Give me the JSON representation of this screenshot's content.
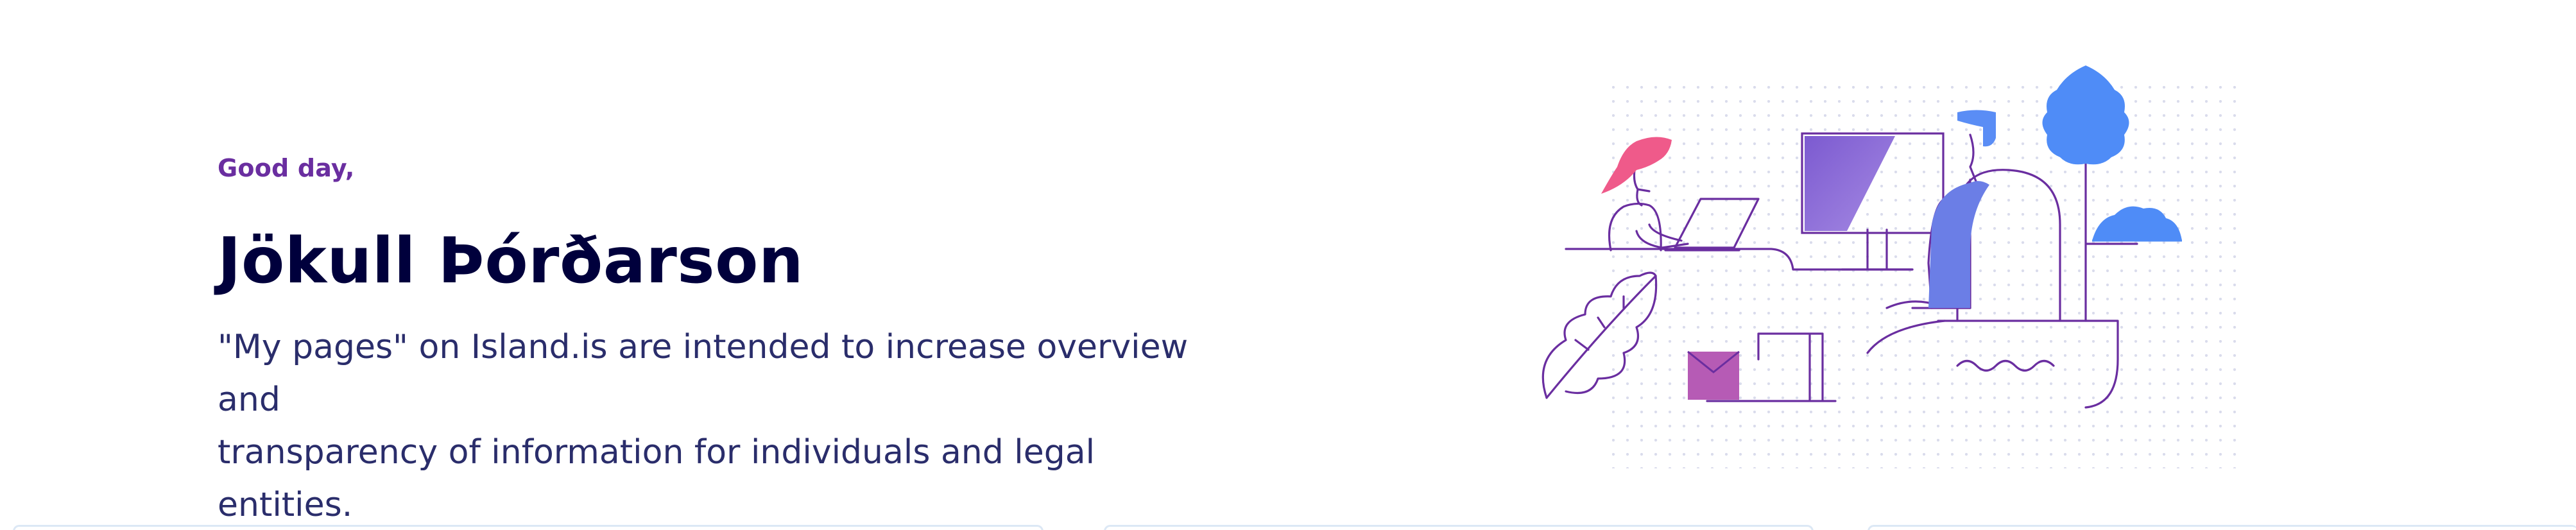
{
  "hero": {
    "greeting": "Good day,",
    "name": "Jökull Þórðarson",
    "intro_line1": "\"My pages\" on Island.is are intended to increase overview and",
    "intro_line2": "transparency of information for individuals and legal entities."
  },
  "illustration": {
    "icon": "office-workers-illustration-icon",
    "colors": {
      "line": "#6a2ea0",
      "pink": "#ef5a8a",
      "blue": "#4f8cf7",
      "purple_fill": "#8a66d8",
      "envelope": "#b65bb5",
      "dots": "#d9dcec"
    }
  },
  "cards": {
    "count_visible": 3,
    "border_color": "#dce8f5"
  }
}
